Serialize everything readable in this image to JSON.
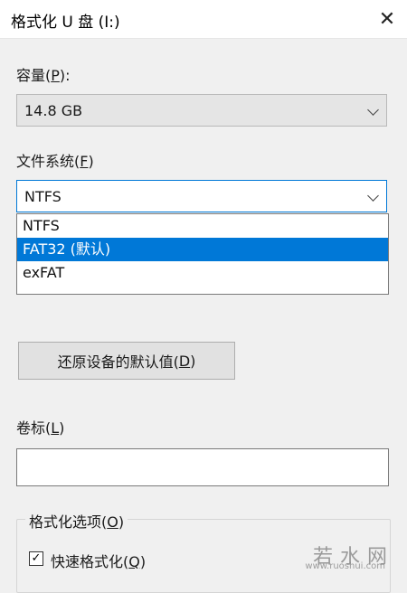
{
  "window": {
    "title": "格式化 U 盘 (I:)",
    "close_glyph": "✕"
  },
  "capacity": {
    "label_prefix": "容量(",
    "label_key": "P",
    "label_suffix": "):",
    "value": "14.8 GB"
  },
  "filesystem": {
    "label_prefix": "文件系统(",
    "label_key": "F",
    "label_suffix": ")",
    "value": "NTFS",
    "options": [
      "NTFS",
      "FAT32 (默认)",
      "exFAT"
    ],
    "highlighted_index": 1
  },
  "restore_button": {
    "label_prefix": "还原设备的默认值(",
    "label_key": "D",
    "label_suffix": ")"
  },
  "volume_label": {
    "label_prefix": "卷标(",
    "label_key": "L",
    "label_suffix": ")",
    "value": ""
  },
  "format_options": {
    "label_prefix": "格式化选项(",
    "label_key": "O",
    "label_suffix": ")",
    "quick_format": {
      "label_prefix": "快速格式化(",
      "label_key": "Q",
      "label_suffix": ")",
      "checked_glyph": "✓"
    }
  },
  "watermark": {
    "main": "若水网",
    "sub": "www.ruoshui.com"
  },
  "colors": {
    "accent": "#0078d7",
    "background": "#f0f0f0"
  }
}
